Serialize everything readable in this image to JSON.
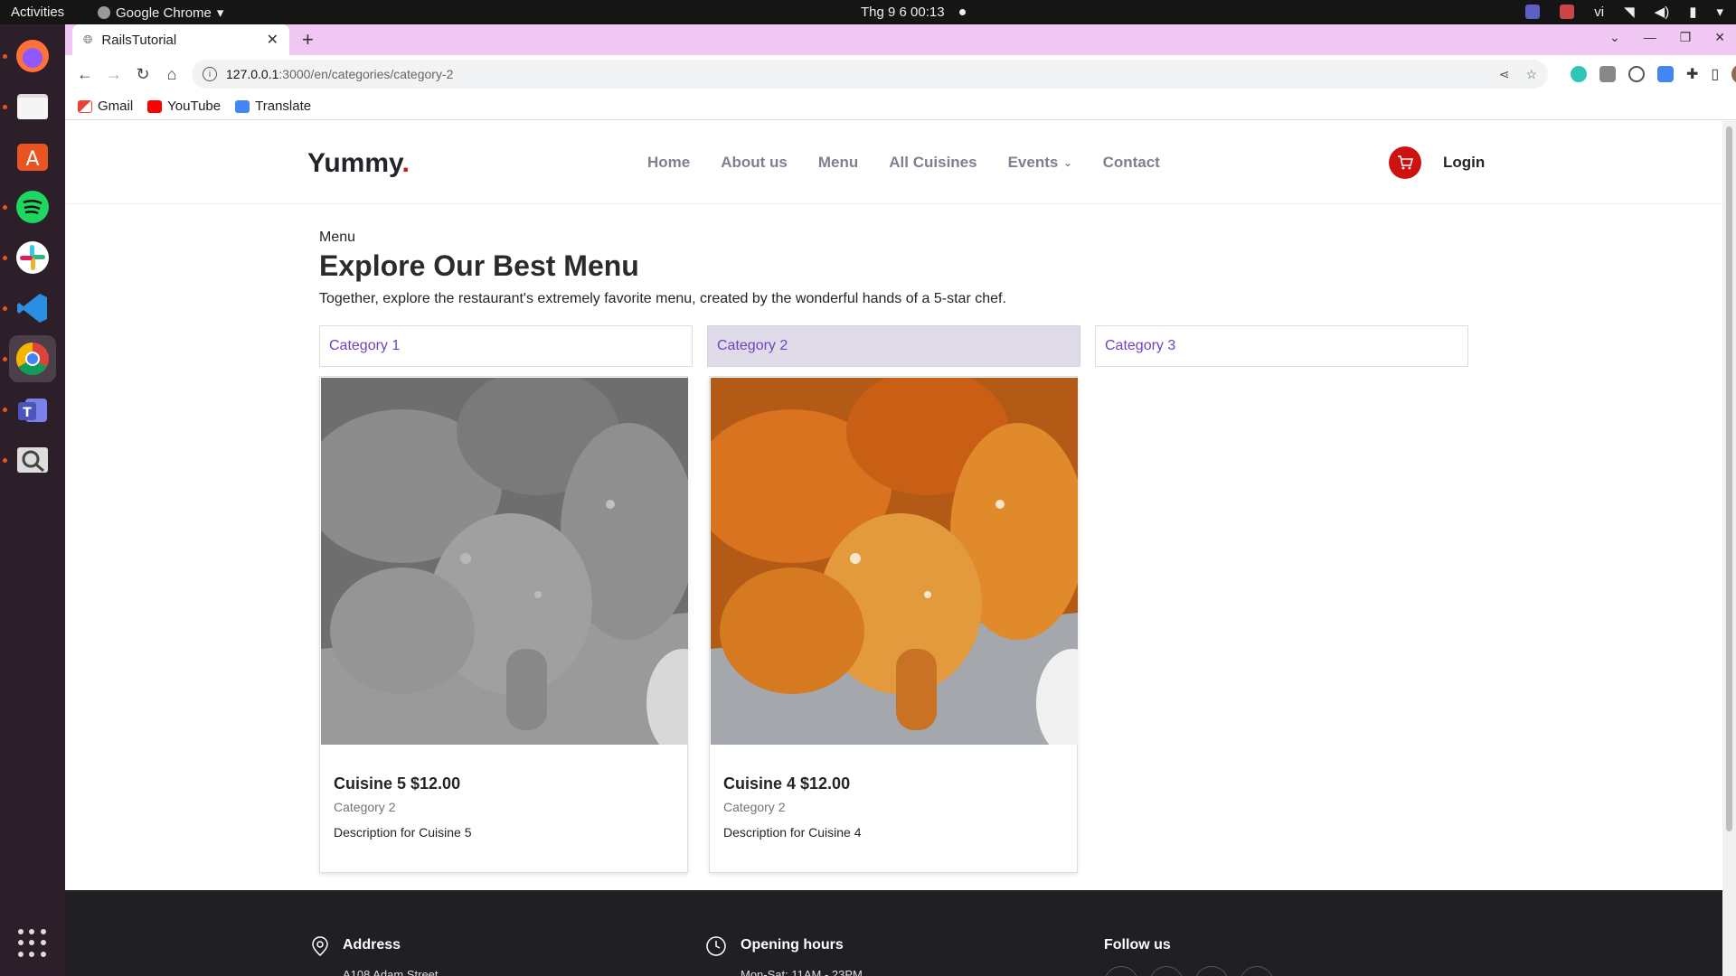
{
  "os": {
    "activities": "Activities",
    "app_name": "Google Chrome",
    "clock": "Thg 9 6  00:13",
    "lang": "vi"
  },
  "browser": {
    "tab_title": "RailsTutorial",
    "url_host": "127.0.0.1",
    "url_path": ":3000/en/categories/category-2",
    "bookmarks": [
      "Gmail",
      "YouTube",
      "Translate"
    ]
  },
  "site": {
    "logo_text": "Yummy",
    "logo_dot": ".",
    "nav": [
      "Home",
      "About us",
      "Menu",
      "All Cuisines",
      "Events",
      "Contact"
    ],
    "login": "Login"
  },
  "menu": {
    "label": "Menu",
    "title": "Explore Our Best Menu",
    "description": "Together, explore the restaurant's extremely favorite menu, created by the wonderful hands of a 5-star chef.",
    "categories": [
      "Category 1",
      "Category 2",
      "Category 3"
    ],
    "active_category": "Category 2",
    "cards": [
      {
        "title": "Cuisine 5 $12.00",
        "category": "Category 2",
        "description": "Description for Cuisine 5"
      },
      {
        "title": "Cuisine 4 $12.00",
        "category": "Category 2",
        "description": "Description for Cuisine 4"
      }
    ]
  },
  "footer": {
    "address_head": "Address",
    "address_text": "A108 Adam Street",
    "hours_head": "Opening hours",
    "hours_text": "Mon-Sat: 11AM - 23PM",
    "follow_head": "Follow us"
  },
  "colors": {
    "brand": "#ce1212",
    "link": "#6f42c1",
    "active_category_bg": "#e0dbe9"
  }
}
